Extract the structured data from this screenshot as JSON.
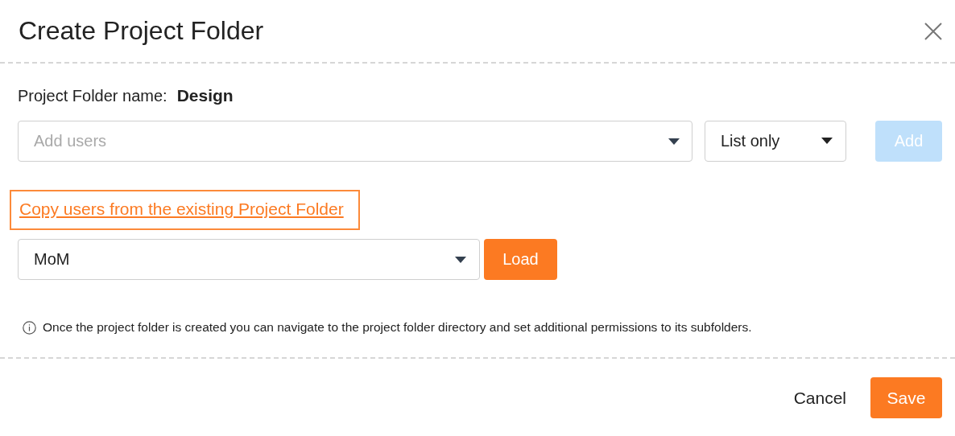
{
  "dialog": {
    "title": "Create Project Folder"
  },
  "folder_name": {
    "label": "Project Folder name:",
    "value": "Design"
  },
  "users_field": {
    "placeholder": "Add users"
  },
  "access_select": {
    "value": "List only"
  },
  "add_button": {
    "label": "Add",
    "disabled": true
  },
  "copy_link": {
    "label": "Copy users from the existing Project Folder",
    "focused": true
  },
  "folder_select": {
    "value": "MoM"
  },
  "load_button": {
    "label": "Load",
    "disabled": false
  },
  "info_note": "Once the project folder is created you can navigate to the project folder directory and set additional permissions to its subfolders.",
  "footer_buttons": [
    {
      "label": "Cancel",
      "kind": "text"
    },
    {
      "label": "Save",
      "kind": "primary"
    }
  ]
}
